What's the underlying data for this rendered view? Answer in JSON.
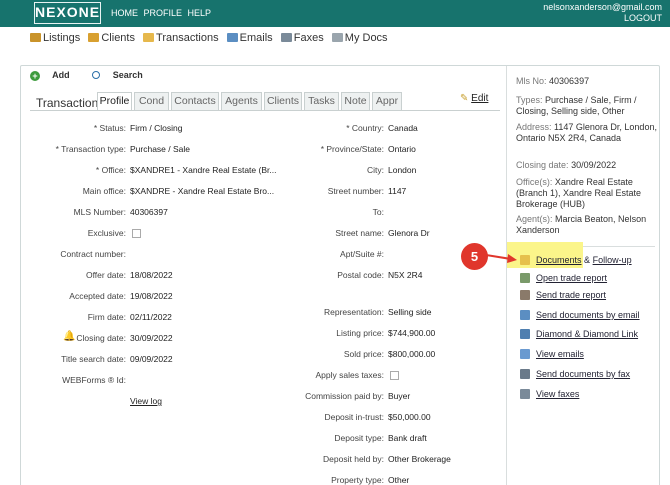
{
  "header": {
    "logo": "NEXONE",
    "nav": [
      "HOME",
      "PROFILE",
      "HELP"
    ],
    "user_email": "nelsonxanderson@gmail.com",
    "logout": "LOGOUT"
  },
  "subnav": [
    {
      "label": "Listings",
      "icon": "house-icon",
      "color": "#c9932a"
    },
    {
      "label": "Clients",
      "icon": "users-icon",
      "color": "#d8a030"
    },
    {
      "label": "Transactions",
      "icon": "folder-icon",
      "color": "#e6b84c"
    },
    {
      "label": "Emails",
      "icon": "envelope-icon",
      "color": "#5b8ec2"
    },
    {
      "label": "Faxes",
      "icon": "fax-icon",
      "color": "#7a8a99"
    },
    {
      "label": "My Docs",
      "icon": "documents-icon",
      "color": "#9aa5ad"
    }
  ],
  "toolbar": {
    "add": "Add",
    "search": "Search"
  },
  "tabs": {
    "title": "Transaction",
    "items": [
      "Profile",
      "Cond",
      "Contacts",
      "Agents",
      "Clients",
      "Tasks",
      "Note",
      "Appr"
    ],
    "active": "Profile",
    "edit": "Edit"
  },
  "left_fields": [
    {
      "label": "* Status:",
      "value": "Firm / Closing"
    },
    {
      "label": "* Transaction type:",
      "value": "Purchase / Sale"
    },
    {
      "label": "* Office:",
      "value": "$XANDRE1 - Xandre Real Estate (Br..."
    },
    {
      "label": "Main office:",
      "value": "$XANDRE - Xandre Real Estate Bro..."
    },
    {
      "label": "MLS Number:",
      "value": "40306397"
    },
    {
      "label": "Exclusive:",
      "value": ""
    },
    {
      "label": "Contract number:",
      "value": ""
    },
    {
      "label": "Offer date:",
      "value": "18/08/2022"
    },
    {
      "label": "Accepted date:",
      "value": "19/08/2022"
    },
    {
      "label": "Firm date:",
      "value": "02/11/2022"
    },
    {
      "label": "Closing date:",
      "value": "30/09/2022"
    },
    {
      "label": "Title search date:",
      "value": "09/09/2022"
    },
    {
      "label": "WEBForms ® Id:",
      "value": ""
    }
  ],
  "view_log": "View log",
  "right_fields": [
    {
      "label": "* Country:",
      "value": "Canada"
    },
    {
      "label": "* Province/State:",
      "value": "Ontario"
    },
    {
      "label": "City:",
      "value": "London"
    },
    {
      "label": "Street number:",
      "value": "1147"
    },
    {
      "label": "To:",
      "value": ""
    },
    {
      "label": "Street name:",
      "value": "Glenora Dr"
    },
    {
      "label": "Apt/Suite #:",
      "value": ""
    },
    {
      "label": "Postal code:",
      "value": "N5X 2R4"
    },
    {
      "label": "Representation:",
      "value": "Selling side"
    },
    {
      "label": "Listing price:",
      "value": "$744,900.00"
    },
    {
      "label": "Sold price:",
      "value": "$800,000.00"
    },
    {
      "label": "Apply sales taxes:",
      "value": ""
    },
    {
      "label": "Commission paid by:",
      "value": "Buyer"
    },
    {
      "label": "Deposit in-trust:",
      "value": "$50,000.00"
    },
    {
      "label": "Deposit type:",
      "value": "Bank draft"
    },
    {
      "label": "Deposit held by:",
      "value": "Other Brokerage"
    },
    {
      "label": "Property type:",
      "value": "Other"
    }
  ],
  "summary": {
    "mls_label": "Mls No:",
    "mls": "40306397",
    "types_label": "Types:",
    "types": "Purchase / Sale, Firm / Closing, Selling side, Other",
    "address_label": "Address:",
    "address": "1147 Glenora Dr, London, Ontario N5X 2R4, Canada",
    "closing_label": "Closing date:",
    "closing": "30/09/2022",
    "offices_label": "Office(s):",
    "offices": "Xandre Real Estate (Branch 1), Xandre Real Estate Brokerage (HUB)",
    "agents_label": "Agent(s):",
    "agents": "Marcia Beaton, Nelson Xanderson"
  },
  "actions": {
    "documents": "Documents",
    "amp": "&",
    "followup": "Follow-up",
    "items": [
      {
        "label": "Open trade report",
        "icon": "report-icon",
        "color": "#7a9a6a"
      },
      {
        "label": "Send trade report",
        "icon": "send-report-icon",
        "color": "#8a7a6a"
      },
      {
        "label": "Send documents by email",
        "icon": "email-docs-icon",
        "color": "#5b8ec2"
      },
      {
        "label": "Diamond & Diamond Link",
        "icon": "link-icon",
        "color": "#4f7fb0"
      },
      {
        "label": "View emails",
        "icon": "emails-icon",
        "color": "#6a9ad0"
      },
      {
        "label": "Send documents by fax",
        "icon": "fax-docs-icon",
        "color": "#6a7a8a"
      },
      {
        "label": "View faxes",
        "icon": "faxes-icon",
        "color": "#7a8a99"
      }
    ]
  },
  "callout": {
    "number": "5",
    "color": "#e0362c"
  }
}
